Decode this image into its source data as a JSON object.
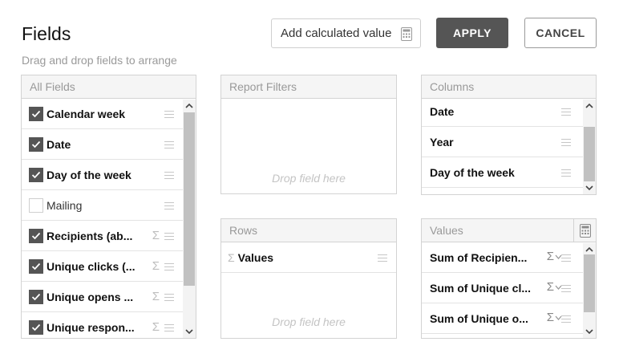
{
  "header": {
    "title": "Fields",
    "subtitle": "Drag and drop fields to arrange",
    "calc_button_label": "Add calculated value",
    "apply_label": "APPLY",
    "cancel_label": "CANCEL"
  },
  "all_fields": {
    "header": "All Fields",
    "items": [
      {
        "label": "Calendar week",
        "checked": true,
        "sigma": false
      },
      {
        "label": "Date",
        "checked": true,
        "sigma": false
      },
      {
        "label": "Day of the week",
        "checked": true,
        "sigma": false
      },
      {
        "label": "Mailing",
        "checked": false,
        "sigma": false
      },
      {
        "label": "Recipients (ab...",
        "checked": true,
        "sigma": true
      },
      {
        "label": "Unique clicks (...",
        "checked": true,
        "sigma": true
      },
      {
        "label": "Unique opens ...",
        "checked": true,
        "sigma": true
      },
      {
        "label": "Unique respon...",
        "checked": true,
        "sigma": true
      }
    ]
  },
  "report_filters": {
    "header": "Report Filters",
    "drop_hint": "Drop field here"
  },
  "rows": {
    "header": "Rows",
    "items": [
      {
        "label": "Values"
      }
    ],
    "drop_hint": "Drop field here"
  },
  "columns": {
    "header": "Columns",
    "items": [
      {
        "label": "Date"
      },
      {
        "label": "Year"
      },
      {
        "label": "Day of the week"
      }
    ]
  },
  "values": {
    "header": "Values",
    "items": [
      {
        "label": "Sum of Recipien..."
      },
      {
        "label": "Sum of Unique cl..."
      },
      {
        "label": "Sum of Unique o..."
      }
    ]
  },
  "colors": {
    "apply_bg": "#555555",
    "checkbox_checked": "#555555",
    "panel_header_bg": "#f5f5f5",
    "border": "#d3d3d3"
  },
  "icons": [
    "calculator-icon",
    "checkmark-icon",
    "drag-handle-icon",
    "sigma-icon",
    "chevron-down-icon",
    "chevron-up-icon"
  ]
}
